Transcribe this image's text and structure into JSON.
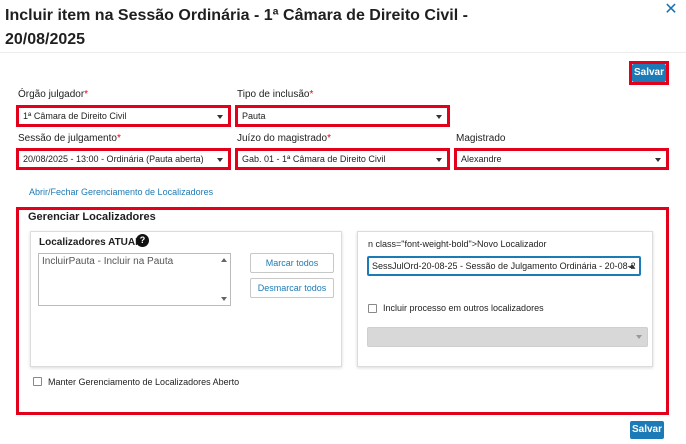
{
  "dialog": {
    "title_line1": "Incluir item na Sessão Ordinária - 1ª Câmara de Direito Civil -",
    "title_line2": "20/08/2025",
    "close_glyph": "✕",
    "save_label": "Salvar",
    "save_bottom_label": "Salvar"
  },
  "form": {
    "orgao_label": "Órgão julgador",
    "orgao_value": "1ª Câmara de Direito Civil",
    "tipo_label": "Tipo de inclusão",
    "tipo_value": "Pauta",
    "sessao_label": "Sessão de julgamento",
    "sessao_value": "20/08/2025 - 13:00 - Ordinária (Pauta aberta)",
    "juizo_label": "Juízo do magistrado",
    "juizo_value": "Gab. 01 - 1ª Câmara de Direito Civil",
    "magistrado_label": "Magistrado",
    "magistrado_value": "Alexandre",
    "required_mark": "*"
  },
  "toggle_link": "Abrir/Fechar Gerenciamento de Localizadores",
  "localizadores": {
    "legend": "Gerenciar Localizadores",
    "atuais_title": "Localizadores ATUAIS",
    "help_glyph": "?",
    "atuais_items": [
      "IncluirPauta - Incluir na Pauta"
    ],
    "marcar_todos": "Marcar todos",
    "desmarcar_todos": "Desmarcar todos",
    "novo_title": "n class=\"font-weight-bold\">Novo Localizador",
    "novo_value": "SessJulOrd-20-08-25 - Sessão de Julgamento Ordinária - 20-08-2",
    "incluir_outros_label": "Incluir processo em outros localizadores",
    "incluir_outros_checked": false,
    "manter_label": "Manter Gerenciamento de Localizadores Aberto",
    "manter_checked": false
  },
  "colors": {
    "accent": "#1c7bb6",
    "highlight": "#e2001a"
  }
}
